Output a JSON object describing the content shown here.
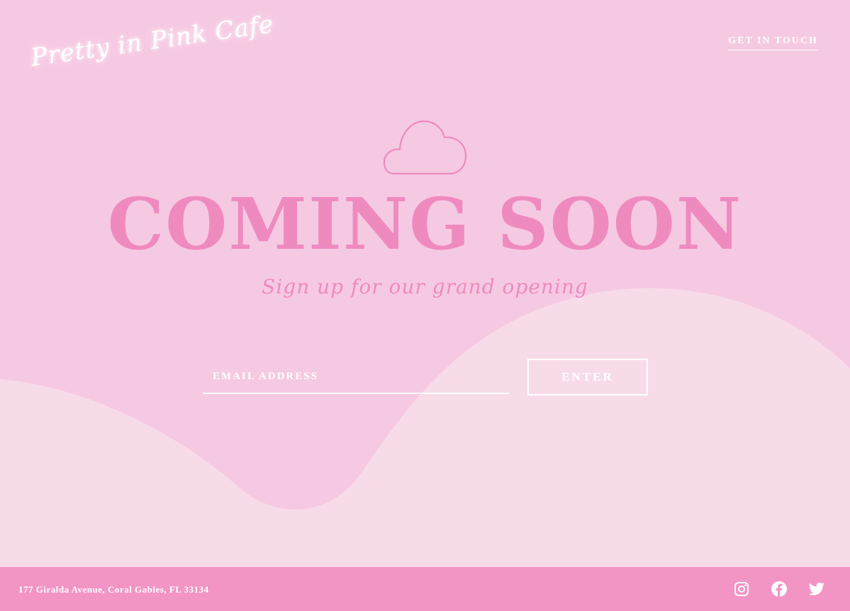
{
  "header": {
    "logo_text": "Pretty in Pink  Cafe",
    "contact_link": "GET IN TOUCH"
  },
  "hero": {
    "icon": "cloud-icon",
    "headline": "COMING SOON",
    "subheadline": "Sign up for our grand opening"
  },
  "signup": {
    "email_placeholder": "EMAIL ADDRESS",
    "email_value": "",
    "submit_label": "ENTER"
  },
  "footer": {
    "address": "177 Giralda Avenue, Coral Gables, FL 33134",
    "social_icons": [
      "instagram-icon",
      "facebook-icon",
      "twitter-icon"
    ]
  },
  "colors": {
    "background": "#f6c9e2",
    "wave_light": "#f8dbe9",
    "accent_pink": "#ef8abf",
    "footer_bar": "#f295c5",
    "text_white": "#ffffff"
  }
}
